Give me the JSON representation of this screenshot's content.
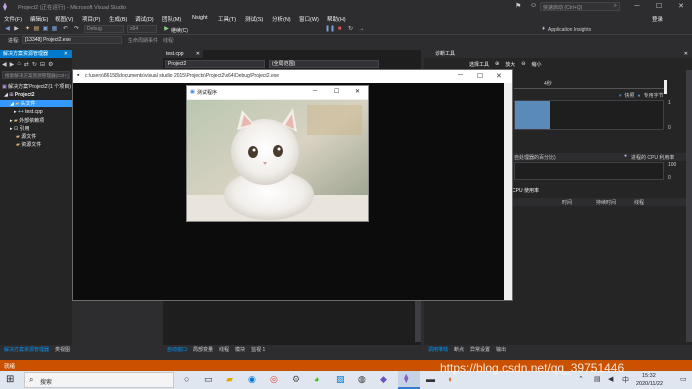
{
  "app": {
    "title": "Project2 (正在运行) - Microsoft Visual Studio",
    "logo_icon": "visual-studio-icon",
    "quick_launch_placeholder": "快速启动 (Ctrl+Q)",
    "sign_in": "登录"
  },
  "menu": [
    "文件(F)",
    "编辑(E)",
    "视图(V)",
    "项目(P)",
    "生成(B)",
    "调试(D)",
    "团队(M)",
    "Nsight",
    "工具(T)",
    "测试(S)",
    "分析(N)",
    "窗口(W)",
    "帮助(H)"
  ],
  "toolbar": {
    "config": "Debug",
    "platform": "x64",
    "continue_label": "继续(C)",
    "app_insights": "Application Insights",
    "process_label": "进程:",
    "process_value": "[13348] Project2.exe",
    "lifecycle_label": "生命周期事件",
    "thread_label": "线程:"
  },
  "solution_explorer": {
    "title": "解决方案资源管理器",
    "search_placeholder": "搜索解决方案资源管理器(Ctrl+;)",
    "items": [
      {
        "label": "解决方案'Project2'(1 个项目)",
        "indent": 0
      },
      {
        "label": "Project2",
        "indent": 1
      },
      {
        "label": "头文件",
        "indent": 2
      },
      {
        "label": "test.cpp",
        "indent": 3
      },
      {
        "label": "外部依赖项",
        "indent": 2
      },
      {
        "label": "引用",
        "indent": 2
      },
      {
        "label": "源文件",
        "indent": 2
      },
      {
        "label": "资源文件",
        "indent": 2
      }
    ],
    "bottom_tabs": [
      "解决方案资源管理器",
      "类视图"
    ]
  },
  "editor": {
    "tab": "test.cpp",
    "scope_project": "Project2",
    "scope_global": "(全局范围)"
  },
  "console": {
    "title": "c:\\users\\86158\\documents\\visual studio 2015\\Projects\\Project2\\x64\\Debug\\Project2.exe"
  },
  "image_window": {
    "title": "测试程序",
    "image_icon": "cat-photo"
  },
  "diagnostics": {
    "title": "诊断工具",
    "select_tools": "选择工具",
    "zoom_in": "放大",
    "zoom_out": "缩小",
    "timeline_tick": "4秒",
    "events_label": "快照",
    "private_bytes": "专用字节",
    "mem_top": "1",
    "mem_bottom": "0",
    "cpu_section": "自处理器的百分比)",
    "cpu_legend": "进程的 CPU 利用率",
    "cpu_top": "100",
    "cpu_bottom": "0",
    "cpu_usage_tab": "CPU 使用率",
    "columns": [
      "时间",
      "持续时间",
      "线程"
    ],
    "bottom_tabs": [
      "调用堆栈",
      "断点",
      "异常设置",
      "输出"
    ]
  },
  "editor_bottom_tabs": [
    "自动窗口",
    "局部变量",
    "线程",
    "模块",
    "监视 1"
  ],
  "status": {
    "text": "就绪"
  },
  "taskbar": {
    "search_placeholder": "搜索",
    "time": "15:32",
    "date": "2020/11/22",
    "watermark": "https://blog.csdn.net/qq_39751446"
  },
  "colors": {
    "vs_dark": "#2d2d30",
    "accent_blue": "#007acc",
    "status_orange": "#ca5100",
    "console_black": "#0c0c0c"
  }
}
